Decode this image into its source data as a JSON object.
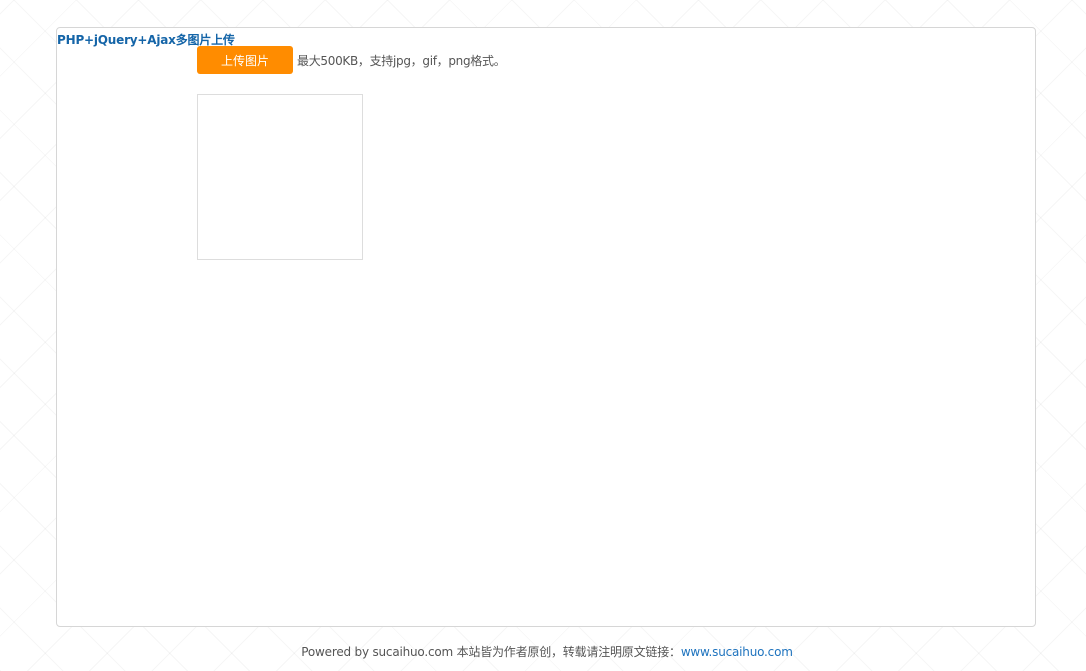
{
  "panel": {
    "title": "PHP+jQuery+Ajax多图片上传"
  },
  "upload": {
    "button_label": "上传图片",
    "hint": "最大500KB，支持jpg，gif，png格式。"
  },
  "footer": {
    "text": "Powered by sucaihuo.com 本站皆为作者原创，转载请注明原文链接：",
    "link_text": "www.sucaihuo.com"
  },
  "colors": {
    "title": "#1565a8",
    "button": "#ff8c00",
    "link": "#1e73be"
  }
}
